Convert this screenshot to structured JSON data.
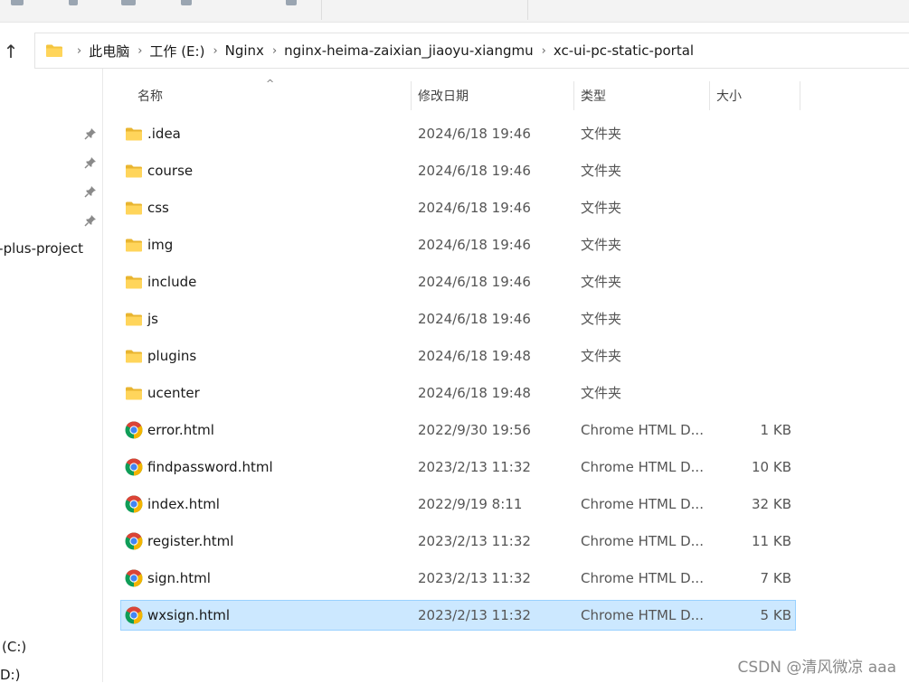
{
  "nav": {
    "up_glyph": "↑",
    "partial_item": "j-plus-project",
    "drive_c": "(C:)",
    "drive_d": "D:)"
  },
  "breadcrumb": [
    "此电脑",
    "工作 (E:)",
    "Nginx",
    "nginx-heima-zaixian_jiaoyu-xiangmu",
    "xc-ui-pc-static-portal"
  ],
  "breadcrumb_separator": "›",
  "columns": {
    "name": "名称",
    "modified": "修改日期",
    "type": "类型",
    "size": "大小",
    "sort_indicator": "^"
  },
  "files": [
    {
      "name": ".idea",
      "modified": "2024/6/18 19:46",
      "type": "文件夹",
      "size": "",
      "icon": "folder-icon"
    },
    {
      "name": "course",
      "modified": "2024/6/18 19:46",
      "type": "文件夹",
      "size": "",
      "icon": "folder-icon"
    },
    {
      "name": "css",
      "modified": "2024/6/18 19:46",
      "type": "文件夹",
      "size": "",
      "icon": "folder-icon"
    },
    {
      "name": "img",
      "modified": "2024/6/18 19:46",
      "type": "文件夹",
      "size": "",
      "icon": "folder-icon"
    },
    {
      "name": "include",
      "modified": "2024/6/18 19:46",
      "type": "文件夹",
      "size": "",
      "icon": "folder-icon"
    },
    {
      "name": "js",
      "modified": "2024/6/18 19:46",
      "type": "文件夹",
      "size": "",
      "icon": "folder-icon"
    },
    {
      "name": "plugins",
      "modified": "2024/6/18 19:48",
      "type": "文件夹",
      "size": "",
      "icon": "folder-icon"
    },
    {
      "name": "ucenter",
      "modified": "2024/6/18 19:48",
      "type": "文件夹",
      "size": "",
      "icon": "folder-icon"
    },
    {
      "name": "error.html",
      "modified": "2022/9/30 19:56",
      "type": "Chrome HTML D...",
      "size": "1 KB",
      "icon": "chrome-icon"
    },
    {
      "name": "findpassword.html",
      "modified": "2023/2/13 11:32",
      "type": "Chrome HTML D...",
      "size": "10 KB",
      "icon": "chrome-icon"
    },
    {
      "name": "index.html",
      "modified": "2022/9/19 8:11",
      "type": "Chrome HTML D...",
      "size": "32 KB",
      "icon": "chrome-icon"
    },
    {
      "name": "register.html",
      "modified": "2023/2/13 11:32",
      "type": "Chrome HTML D...",
      "size": "11 KB",
      "icon": "chrome-icon"
    },
    {
      "name": "sign.html",
      "modified": "2023/2/13 11:32",
      "type": "Chrome HTML D...",
      "size": "7 KB",
      "icon": "chrome-icon"
    },
    {
      "name": "wxsign.html",
      "modified": "2023/2/13 11:32",
      "type": "Chrome HTML D...",
      "size": "5 KB",
      "icon": "chrome-icon",
      "selected": true
    }
  ],
  "watermark": "CSDN @清风微凉 aaa",
  "colors": {
    "selection_bg": "#cce8ff",
    "selection_border": "#99d1ff",
    "folder": "#f4c53f",
    "chrome_red": "#db4437",
    "chrome_yellow": "#f4b400",
    "chrome_green": "#0f9d58",
    "chrome_blue": "#4285f4"
  }
}
